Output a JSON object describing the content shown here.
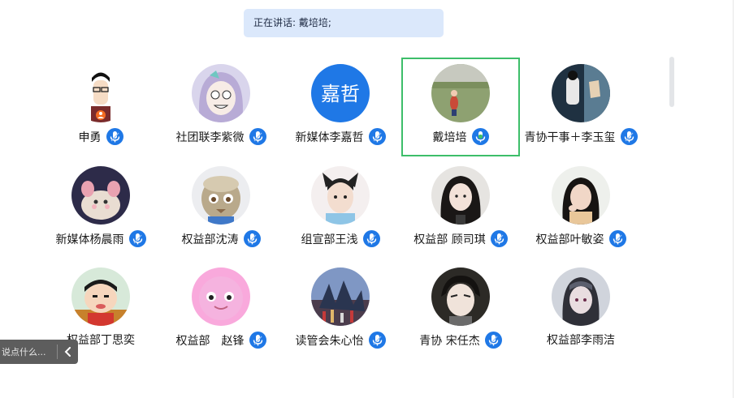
{
  "banner": {
    "text": "正在讲话: 戴培培;"
  },
  "comment": {
    "placeholder": "说点什么..."
  },
  "colors": {
    "accent": "#1f78e6",
    "active_border": "#3dbe6a",
    "banner_bg": "#dbe8fb"
  },
  "participants": [
    {
      "name": "申勇",
      "mic": "mic-icon",
      "speaking": false
    },
    {
      "name": "社团联李紫微",
      "mic": "mic-icon",
      "speaking": false
    },
    {
      "name": "新媒体李嘉哲",
      "avatar_text": "嘉哲",
      "mic": "mic-icon",
      "speaking": false
    },
    {
      "name": "戴培培",
      "mic": "mic-speaking-icon",
      "speaking": true
    },
    {
      "name": "青协干事＋李玉玺",
      "mic": "mic-icon",
      "speaking": false
    },
    {
      "name": "新媒体杨晨雨",
      "mic": "mic-icon",
      "speaking": false
    },
    {
      "name": "权益部沈涛",
      "mic": "mic-icon",
      "speaking": false
    },
    {
      "name": "组宣部王浅",
      "mic": "mic-icon",
      "speaking": false
    },
    {
      "name": "权益部 顾司琪",
      "mic": "mic-icon",
      "speaking": false
    },
    {
      "name": "权益部叶敏姿",
      "mic": "mic-icon",
      "speaking": false
    },
    {
      "name": "权益部丁思奕",
      "mic": null,
      "speaking": false
    },
    {
      "name": "权益部　赵锋",
      "mic": "mic-icon",
      "speaking": false
    },
    {
      "name": "读管会朱心怡",
      "mic": "mic-icon",
      "speaking": false
    },
    {
      "name": "青协 宋任杰",
      "mic": "mic-icon",
      "speaking": false
    },
    {
      "name": "权益部李雨洁",
      "mic": null,
      "speaking": false
    }
  ]
}
